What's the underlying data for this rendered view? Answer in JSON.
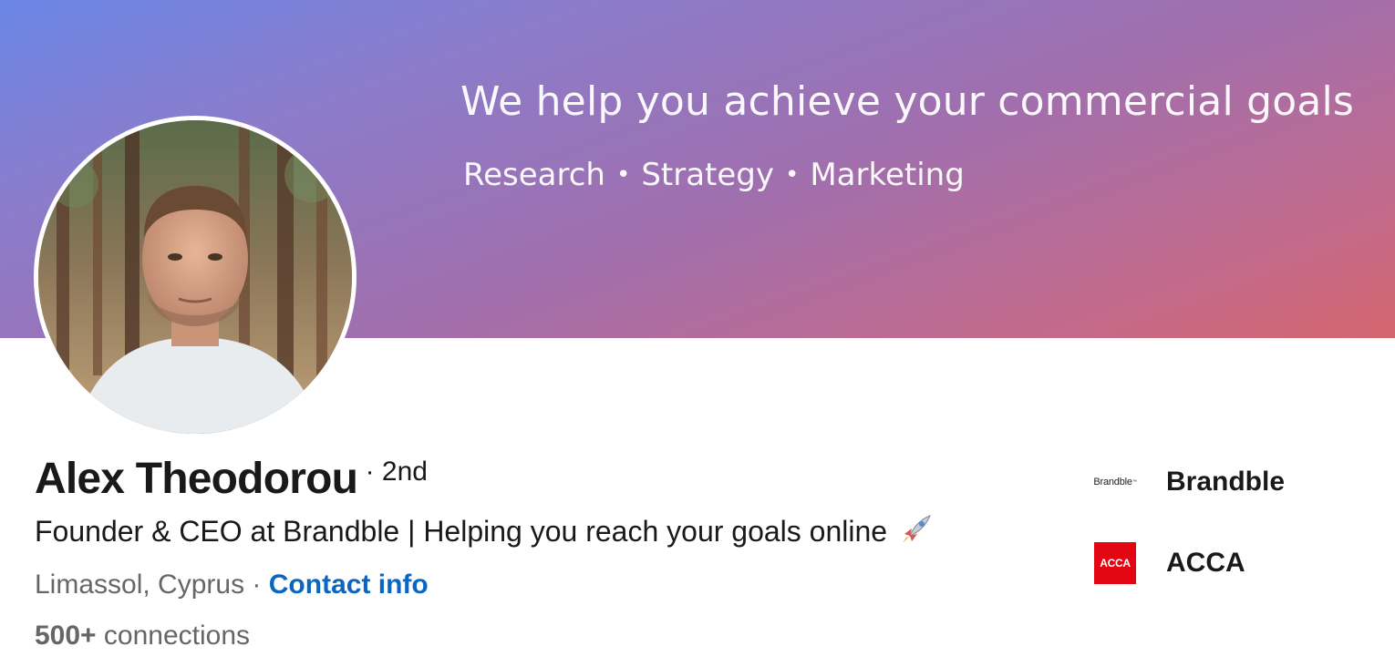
{
  "banner": {
    "headline": "We help you achieve your commercial goals",
    "subline_items": [
      "Research",
      "Strategy",
      "Marketing"
    ],
    "separator": "•"
  },
  "profile": {
    "name": "Alex Theodorou",
    "degree": "· 2nd",
    "headline": "Founder & CEO at Brandble | Helping you reach your goals online",
    "location": "Limassol, Cyprus",
    "location_separator": "·",
    "contact_info_label": "Contact info",
    "connections_count": "500+",
    "connections_label": "connections"
  },
  "organizations": [
    {
      "name": "Brandble",
      "logo_text": "Brandble",
      "logo_mark": "™"
    },
    {
      "name": "ACCA",
      "logo_text": "ACCA",
      "logo_color": "#e30613"
    }
  ],
  "colors": {
    "banner_gradient": [
      "#6a86e6",
      "#8b7ccb",
      "#a06fae",
      "#c46a8a",
      "#d4656d"
    ],
    "link": "#0a66c2",
    "secondary_text": "#666666",
    "primary_text": "#191919"
  },
  "icons": {
    "headline_emoji": "rocket-icon"
  }
}
